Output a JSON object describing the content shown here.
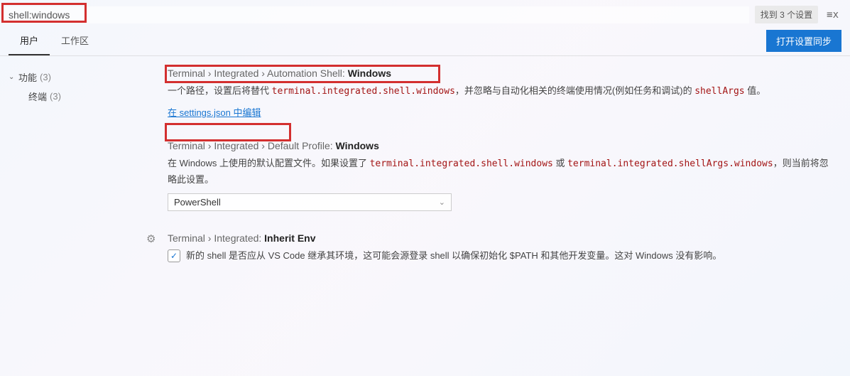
{
  "search": {
    "value": "shell:windows",
    "found_label": "找到 3 个设置"
  },
  "tabs": {
    "user": "用户",
    "workspace": "工作区",
    "sync_button": "打开设置同步"
  },
  "sidebar": {
    "group_label": "功能",
    "group_count": "(3)",
    "child_label": "终端",
    "child_count": "(3)"
  },
  "settings": [
    {
      "path_prefix": "Terminal › Integrated › Automation Shell: ",
      "path_leaf": "Windows",
      "desc_pre": "一个路径，设置后将替代 ",
      "desc_code1": "terminal.integrated.shell.windows",
      "desc_mid": "，并忽略与自动化相关的终端使用情况(例如任务和调试)的 ",
      "desc_code2": "shellArgs",
      "desc_post": " 值。",
      "edit_link": "在 settings.json 中编辑"
    },
    {
      "path_prefix": "Terminal › Integrated › Default Profile: ",
      "path_leaf": "Windows",
      "desc_pre": "在 Windows 上使用的默认配置文件。如果设置了 ",
      "desc_code1": "terminal.integrated.shell.windows",
      "desc_mid": " 或 ",
      "desc_code2": "terminal.integrated.shellArgs.windows",
      "desc_post": "，则当前将忽略此设置。",
      "select_value": "PowerShell"
    },
    {
      "path_prefix": "Terminal › Integrated: ",
      "path_leaf": "Inherit Env",
      "checkbox_label": "新的 shell 是否应从 VS Code 继承其环境，这可能会源登录 shell 以确保初始化 $PATH 和其他开发变量。这对 Windows 没有影响。",
      "checked": true
    }
  ]
}
